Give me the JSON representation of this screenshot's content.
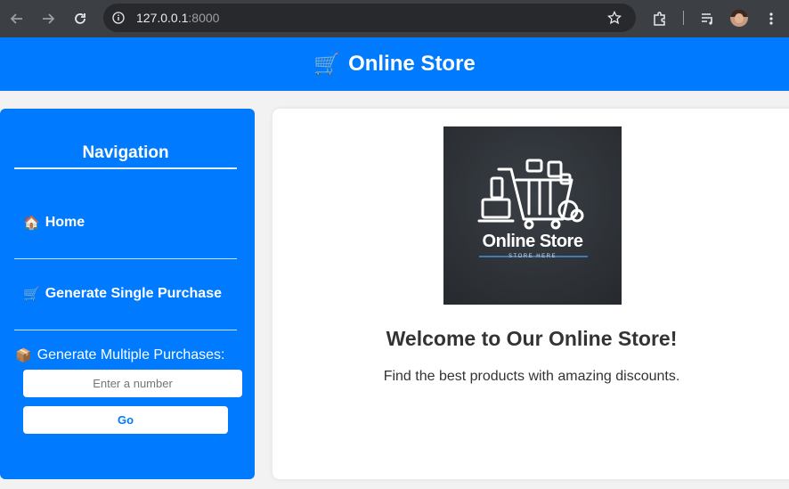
{
  "browser": {
    "url_host": "127.0.0.1",
    "url_port": ":8000"
  },
  "header": {
    "cart_icon": "🛒",
    "title": "Online Store"
  },
  "sidebar": {
    "heading": "Navigation",
    "home": {
      "icon": "🏠",
      "label": "Home"
    },
    "single": {
      "icon": "🛒",
      "label": "Generate Single Purchase"
    },
    "multiple": {
      "icon": "📦",
      "label": "Generate Multiple Purchases:",
      "placeholder": "Enter a number",
      "button_label": "Go"
    }
  },
  "main": {
    "logo": {
      "title": "Online Store",
      "subtitle": "STORE HERE"
    },
    "welcome": "Welcome to Our Online Store!",
    "tagline": "Find the best products with amazing discounts."
  },
  "colors": {
    "primary": "#007bff",
    "chrome": "#3c3f43",
    "text": "#333333"
  }
}
